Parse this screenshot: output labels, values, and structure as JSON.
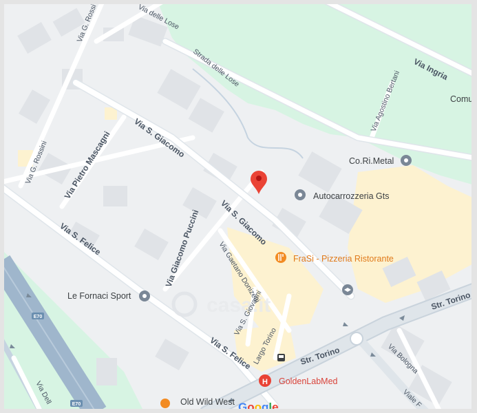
{
  "map": {
    "colors": {
      "background": "#eef0f2",
      "park": "#d7f4e3",
      "road": "#ffffff",
      "major_road": "#dfe5ea",
      "highway": "#9fb6cc",
      "building": "#e0e3e7",
      "commercial": "#fdf2d0",
      "pin": "#ea4335"
    },
    "streets": {
      "via_g_rossini_top": "Via G. Rossi",
      "via_g_rossini": "Via G. Rossini",
      "via_delle_lose": "Via delle Lose",
      "strada_delle_lose": "Strada delle Lose",
      "via_ingria": "Via Ingria",
      "via_agostino_bertani": "Via Agostino Bertani",
      "via_pietro_mascagni": "Via Pietro Mascagni",
      "via_s_giacomo_1": "Via S. Giacomo",
      "via_s_giacomo_2": "Via S. Giacomo",
      "via_s_felice_1": "Via S. Felice",
      "via_s_felice_2": "Via S. Felice",
      "via_giacomo_puccini": "Via Giacomo Puccini",
      "via_gaetano_donizetti": "Via Gaetano Donizetti",
      "via_s_giovanni": "Via S. Giovanni",
      "largo_torino": "Largo Torino",
      "str_torino_1": "Str. Torino",
      "str_torino_2": "Str. Torino",
      "via_bologna": "Via Bologna",
      "viale_f": "Viale F",
      "via_dell": "Via Dell",
      "comu": "Comu"
    },
    "highway_shields": [
      "E70",
      "E70"
    ],
    "pois": {
      "co_ri_metal": "Co.Ri.Metal",
      "autocarrozzeria": "Autocarrozzeria Gts",
      "frasi": "FraSi - Pizzeria Ristorante",
      "le_fornaci": "Le Fornaci Sport",
      "goldenlab": "GoldenLabMed",
      "old_wild_west": "Old Wild West"
    },
    "watermark": "casa.it",
    "google_logo": "Google",
    "google_logo_colors": [
      "#4285f4",
      "#ea4335",
      "#fbbc05",
      "#4285f4",
      "#34a853",
      "#ea4335"
    ]
  }
}
